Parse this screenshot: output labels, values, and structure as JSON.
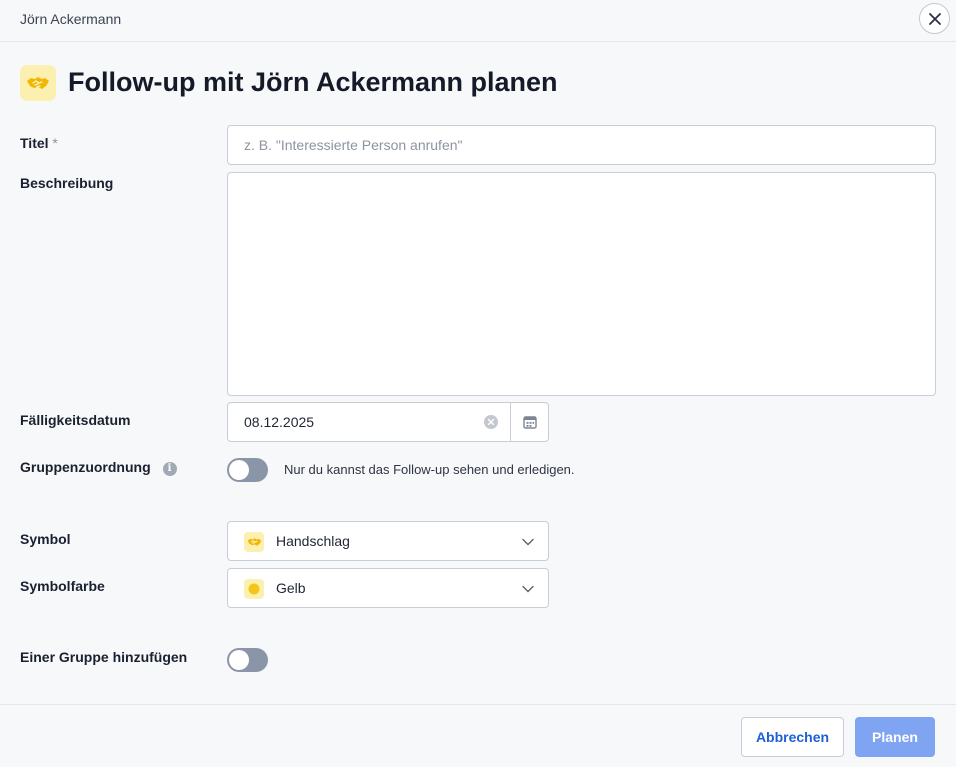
{
  "window": {
    "title": "Jörn Ackermann",
    "close_icon": "close-icon"
  },
  "heading": {
    "title": "Follow-up mit Jörn Ackermann planen",
    "icon": "handshake-icon"
  },
  "form": {
    "title_label": "Titel",
    "title_required": "*",
    "title_placeholder": "z. B. \"Interessierte Person anrufen\"",
    "title_value": "",
    "description_label": "Beschreibung",
    "description_value": "",
    "due_date_label": "Fälligkeitsdatum",
    "due_date_value": "08.12.2025",
    "group_assign_label": "Gruppenzuordnung",
    "group_assign_on": false,
    "group_assign_hint": "Nur du kannst das Follow-up sehen und erledigen.",
    "symbol_label": "Symbol",
    "symbol_value": "Handschlag",
    "symbol_color_label": "Symbolfarbe",
    "symbol_color_value": "Gelb",
    "add_to_group_label": "Einer Gruppe hinzufügen",
    "add_to_group_on": false
  },
  "colors": {
    "accent": "#1f5fd6",
    "primary_button": "#7ea4f2",
    "symbol_yellow": "#f5c518",
    "toggle_off": "#8a95a8"
  },
  "footer": {
    "cancel_label": "Abbrechen",
    "submit_label": "Planen"
  }
}
